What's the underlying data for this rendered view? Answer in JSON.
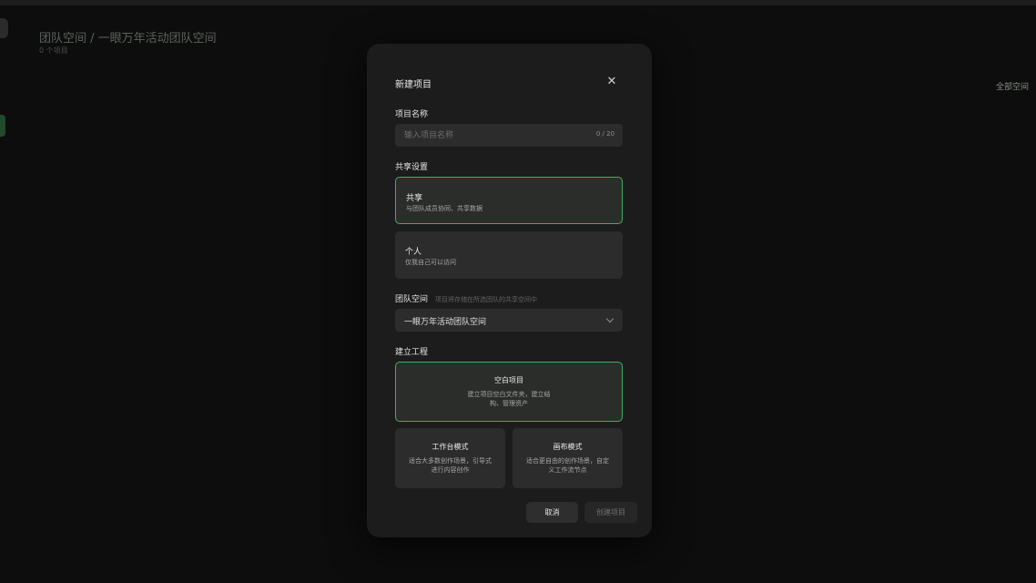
{
  "background": {
    "breadcrumb": "团队空间 / 一眼万年活动团队空间",
    "subtitle": "0 个项目",
    "right_label": "全部空间"
  },
  "dialog": {
    "title": "新建项目",
    "close_icon": "close-icon",
    "name_label": "项目名称",
    "name_value": "",
    "name_placeholder": "输入项目名称",
    "name_counter": "0 / 20",
    "share_label": "共享设置",
    "share_options": [
      {
        "name": "共享",
        "desc": "与团队成员协同、共享数据",
        "selected": true
      },
      {
        "name": "个人",
        "desc": "仅我自己可以访问",
        "selected": false
      }
    ],
    "space_label": "团队空间",
    "space_hint": "项目将存储在所选团队的共享空间中",
    "space_value": "一眼万年活动团队空间",
    "build_label": "建立工程",
    "build_options": [
      {
        "name": "空白项目",
        "desc": "建立项目空白文件夹，建立结构、管理资产",
        "selected": true
      },
      {
        "name": "工作台模式",
        "desc": "适合大多数创作场景，引导式进行内容创作",
        "selected": false
      },
      {
        "name": "画布模式",
        "desc": "适合更自由的创作场景，自定义工作流节点",
        "selected": false
      }
    ],
    "cancel_label": "取消",
    "create_label": "创建项目"
  },
  "colors": {
    "accent": "#3fae63",
    "dialog_bg": "#1c1c1c",
    "field_bg": "#2c2c2c",
    "page_bg": "#0c0d0c"
  }
}
